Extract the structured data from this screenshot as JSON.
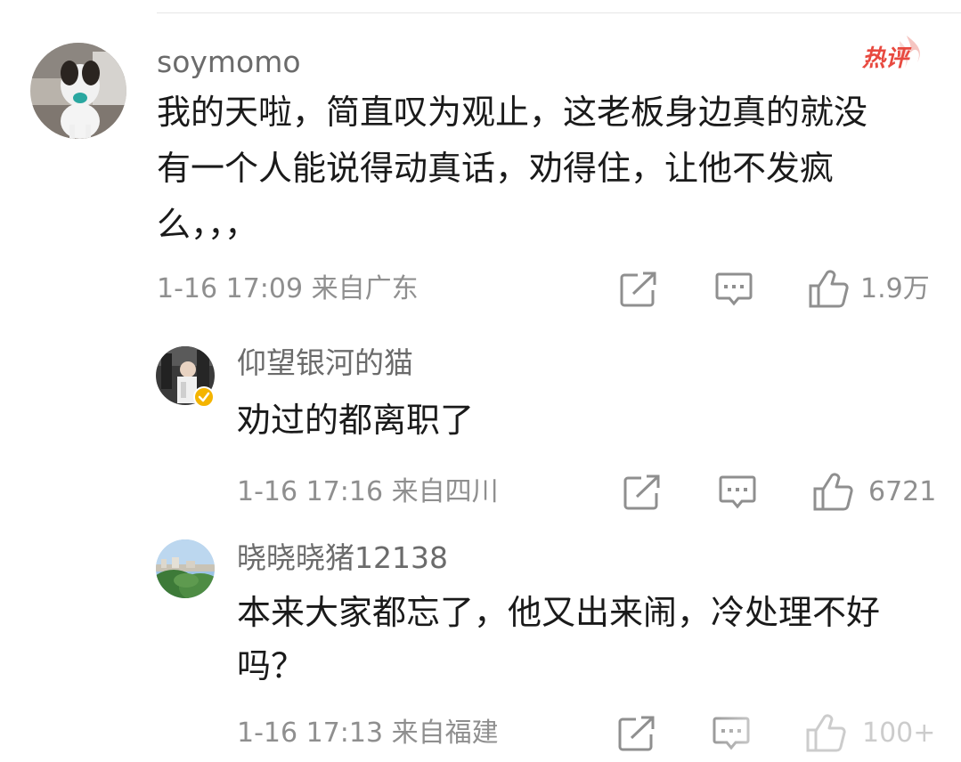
{
  "comments": [
    {
      "username": "soymomo",
      "badge": "热评",
      "text": "我的天啦，简直叹为观止，这老板身边真的就没\n有一个人能说得动真话，劝得住，让他不发疯\n么，，，",
      "meta": "1-16 17:09 来自广东",
      "likes": "1.9万"
    },
    {
      "username": "仰望银河的猫",
      "text": "劝过的都离职了",
      "meta": "1-16 17:16 来自四川",
      "likes": "6721"
    },
    {
      "username": "晓晓晓猪12138",
      "text": "本来大家都忘了，他又出来闹，冷处理不好\n吗？",
      "meta": "1-16 17:13 来自福建",
      "likes": "100+"
    }
  ],
  "icons": {
    "share": "share-icon",
    "comment": "comment-icon",
    "like": "like-icon",
    "verified": "verified-icon",
    "hot": "hot-comment-badge"
  },
  "colors": {
    "hot_badge": "#e8493f",
    "verified": "#f4b400",
    "meta_gray": "#8f8f8f",
    "username_gray": "#6b6b6b"
  }
}
